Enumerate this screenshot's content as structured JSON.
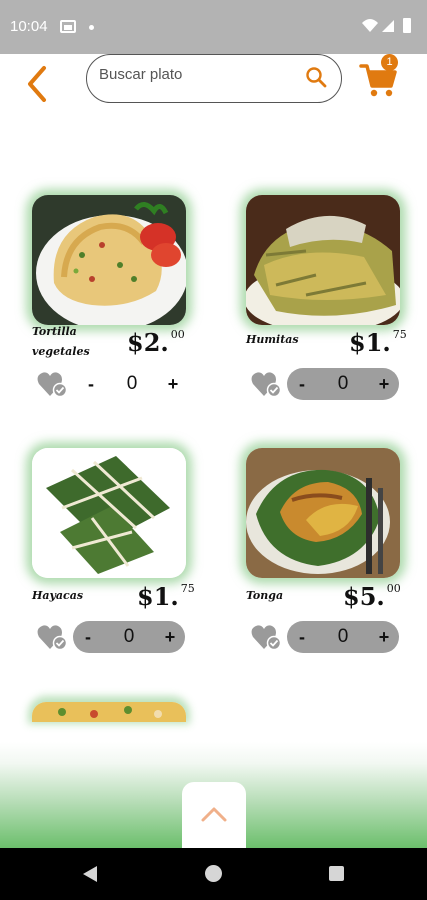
{
  "status_bar": {
    "time": "10:04",
    "icons": [
      "image-notification-icon",
      "dot-icon",
      "wifi-icon",
      "signal-icon",
      "battery-icon"
    ]
  },
  "header": {
    "back_icon": "chevron-left-icon",
    "search": {
      "placeholder": "Buscar plato",
      "value": ""
    },
    "cart": {
      "icon": "cart-icon",
      "badge": "1"
    }
  },
  "products": [
    {
      "name": "Tortilla vegetales",
      "price_main": "$2.",
      "price_cents": "00",
      "quantity": "0",
      "stepper_style": "plain"
    },
    {
      "name": "Humitas",
      "price_main": "$1.",
      "price_cents": "75",
      "quantity": "0",
      "stepper_style": "filled"
    },
    {
      "name": "Hayacas",
      "price_main": "$1.",
      "price_cents": "75",
      "quantity": "0",
      "stepper_style": "filled"
    },
    {
      "name": "Tonga",
      "price_main": "$5.",
      "price_cents": "00",
      "quantity": "0",
      "stepper_style": "filled"
    }
  ],
  "stepper": {
    "minus": "-",
    "plus": "+"
  },
  "colors": {
    "accent": "#e07a10",
    "stepper_bg": "#9e9e9e",
    "glow": "#6ebe6e",
    "fav_heart": "#9a9a9a"
  },
  "scroll_top_icon": "chevron-up-icon",
  "nav_bar": {
    "icons": [
      "nav-back-icon",
      "nav-home-icon",
      "nav-recents-icon"
    ]
  }
}
